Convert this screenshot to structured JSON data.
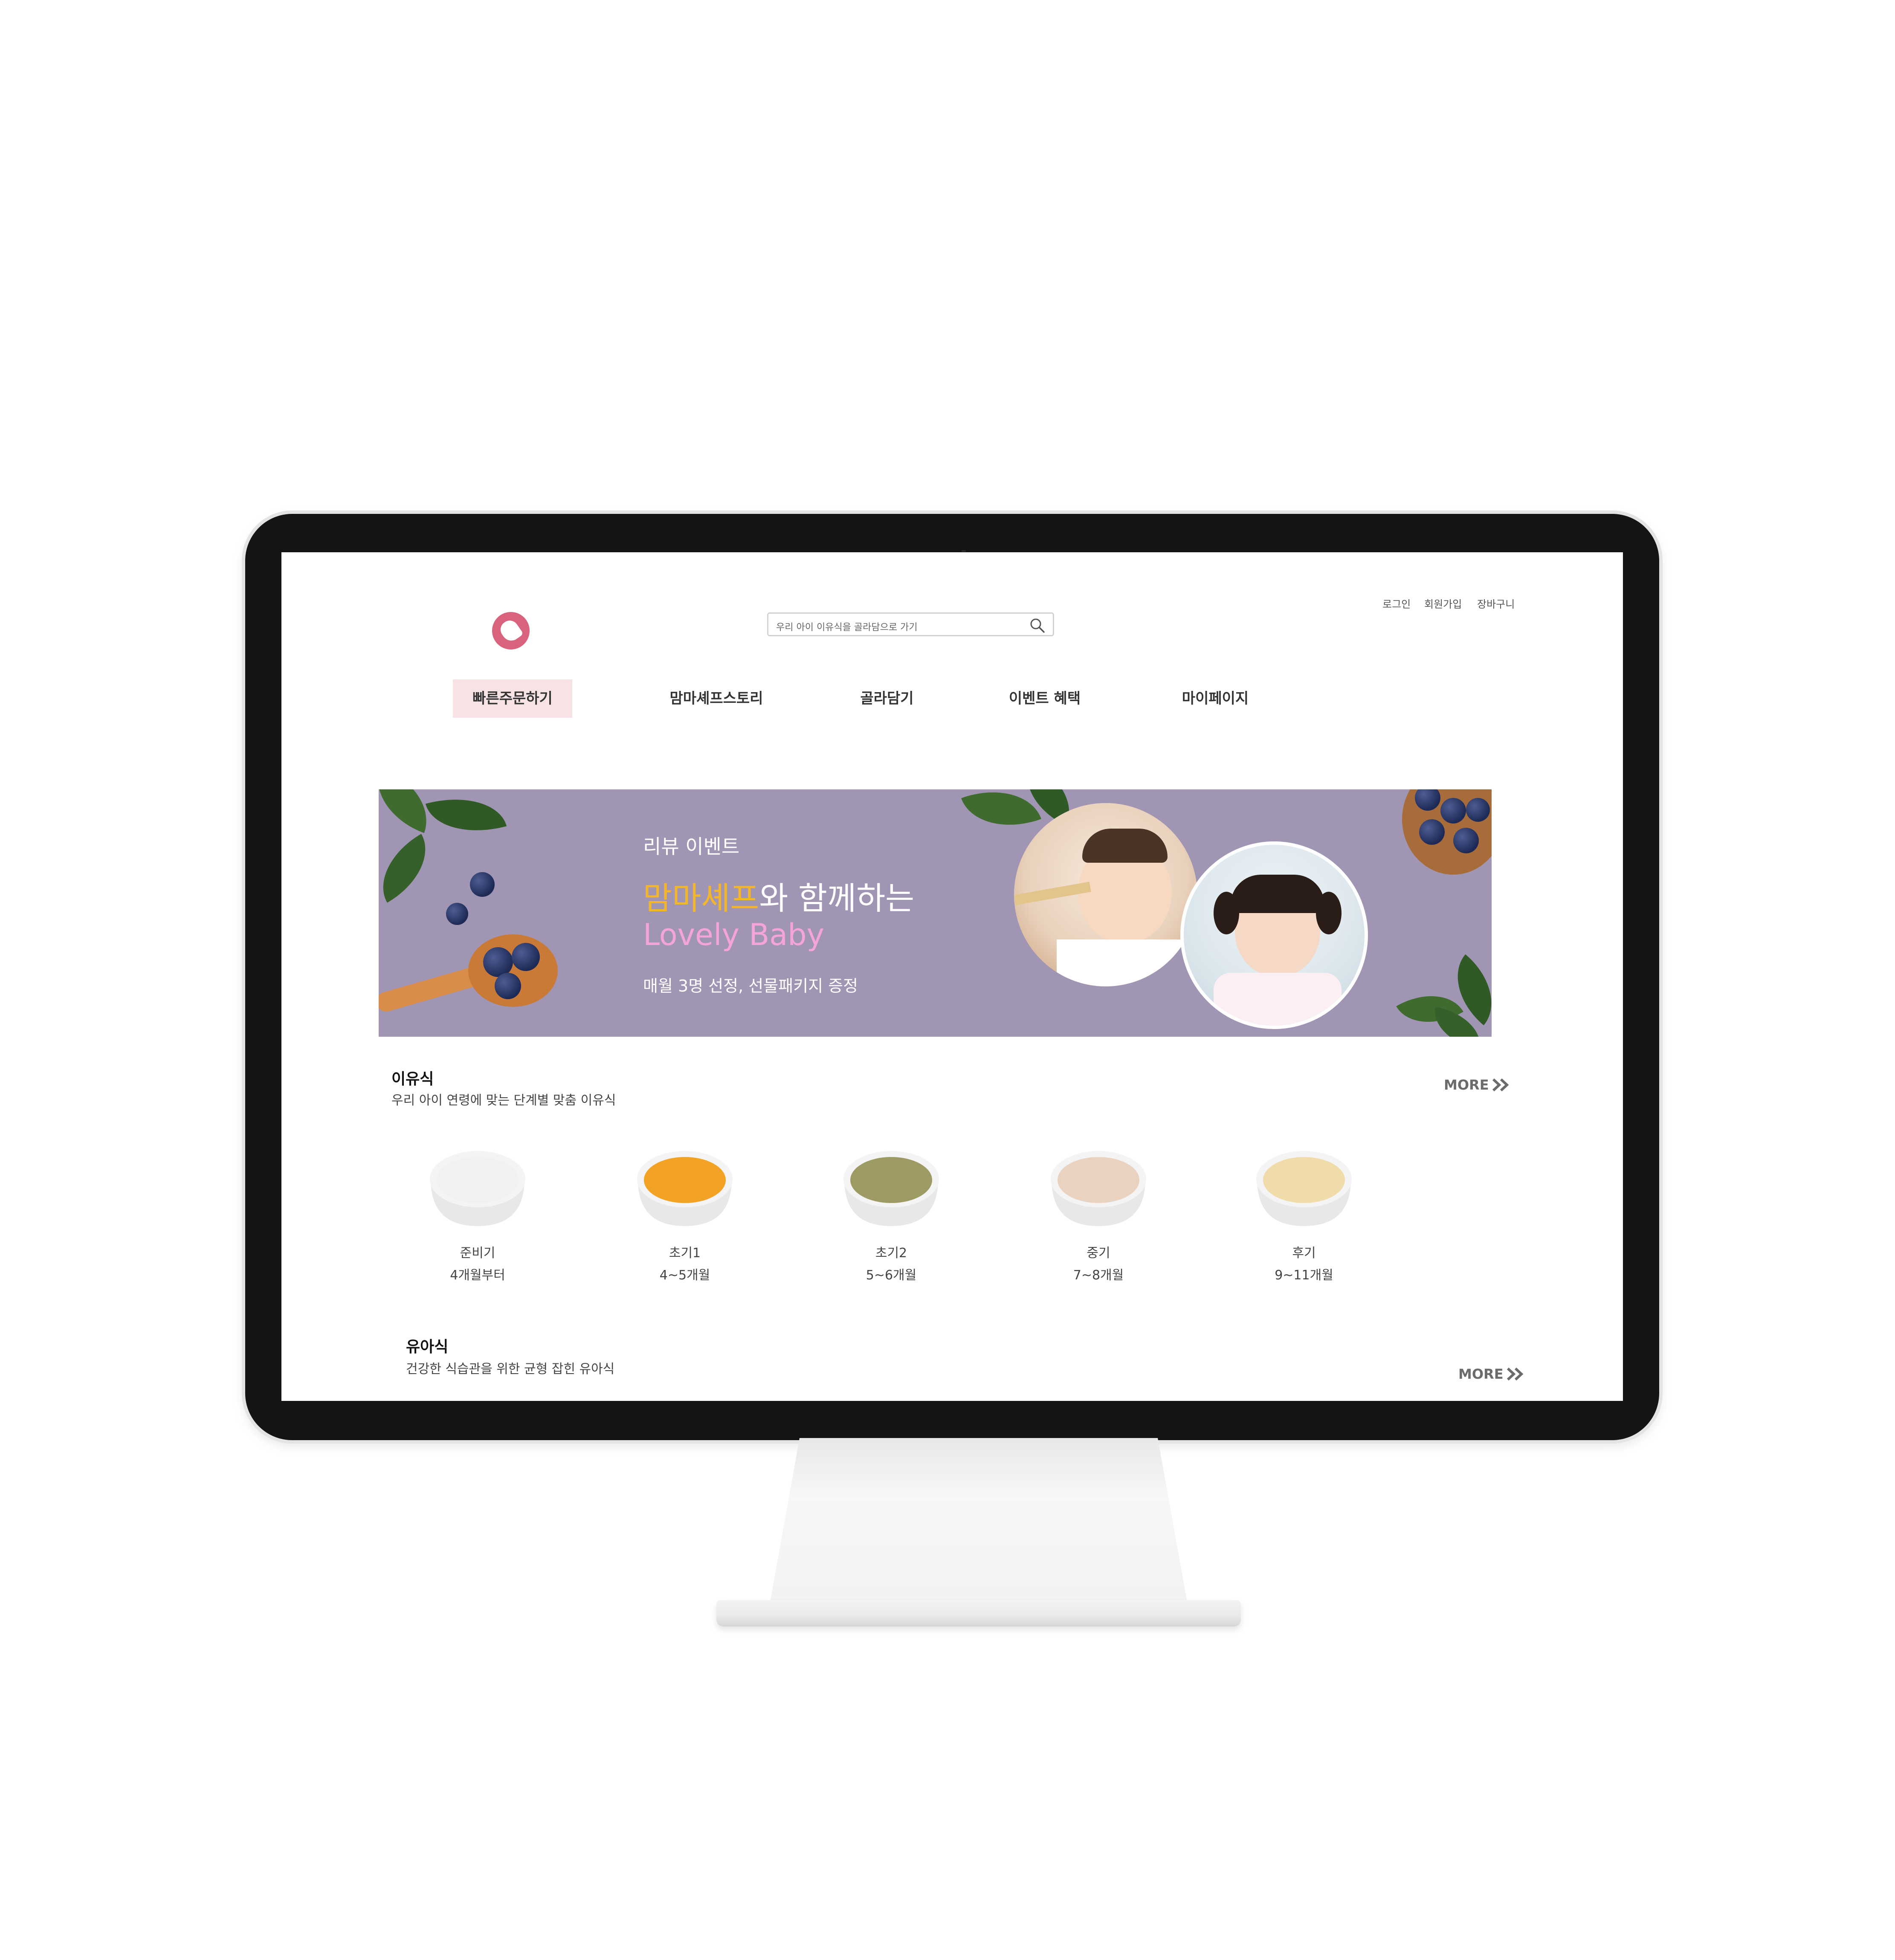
{
  "header": {
    "search": {
      "placeholder": "우리 아이 이유식을 골라담으로 가기"
    },
    "util_links": [
      "로그인",
      "회원가입",
      "장바구니"
    ]
  },
  "nav": {
    "items": [
      "빠른주문하기",
      "맘마셰프스토리",
      "골라담기",
      "이벤트 혜택",
      "마이페이지"
    ],
    "active_index": 0
  },
  "banner": {
    "eyebrow": "리뷰 이벤트",
    "title_highlight": "맘마셰프",
    "title_rest": "와 함께하는",
    "subtitle": "Lovely Baby",
    "description": "매월 3명 선정, 선물패키지 증정",
    "bg_color": "#a195b4"
  },
  "sections": [
    {
      "title": "이유식",
      "subtitle": "우리 아이 연령에 맞는 단계별 맞춤 이유식",
      "more_label": "MORE",
      "products": [
        {
          "name": "준비기",
          "age": "4개월부터",
          "color": "#f1f1f1"
        },
        {
          "name": "초기1",
          "age": "4~5개월",
          "color": "#f2a323"
        },
        {
          "name": "초기2",
          "age": "5~6개월",
          "color": "#9e9a63"
        },
        {
          "name": "중기",
          "age": "7~8개월",
          "color": "#ead2c1"
        },
        {
          "name": "후기",
          "age": "9~11개월",
          "color": "#f0dcaa"
        }
      ]
    },
    {
      "title": "유아식",
      "subtitle": "건강한 식습관을 위한 균형 잡힌 유아식",
      "more_label": "MORE"
    }
  ],
  "colors": {
    "brand": "#d9637c",
    "nav_active_bg": "#f7e3e6"
  }
}
